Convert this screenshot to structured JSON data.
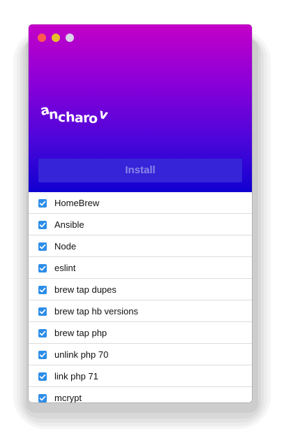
{
  "window": {
    "controls": [
      "close",
      "minimize",
      "maximize"
    ],
    "colors": {
      "gradient_top": "#c400c8",
      "gradient_bottom": "#1000d0",
      "close": "#ff5a52",
      "minimize": "#e6c029",
      "maximize": "#d9d3e8"
    }
  },
  "header": {
    "logo_text": "ancharov",
    "logo_letters": [
      "a",
      "n",
      "c",
      "h",
      "a",
      "r",
      "o",
      "v"
    ]
  },
  "install_button": {
    "label": "Install",
    "enabled": false,
    "background": "#3524d8"
  },
  "tasks": {
    "checkbox_color": "#2d8de8",
    "items": [
      {
        "label": "HomeBrew",
        "checked": true
      },
      {
        "label": "Ansible",
        "checked": true
      },
      {
        "label": "Node",
        "checked": true
      },
      {
        "label": "eslint",
        "checked": true
      },
      {
        "label": "brew tap dupes",
        "checked": true
      },
      {
        "label": "brew tap hb versions",
        "checked": true
      },
      {
        "label": "brew tap php",
        "checked": true
      },
      {
        "label": "unlink php 70",
        "checked": true
      },
      {
        "label": "link php 71",
        "checked": true
      },
      {
        "label": "mcrypt",
        "checked": true
      }
    ]
  }
}
